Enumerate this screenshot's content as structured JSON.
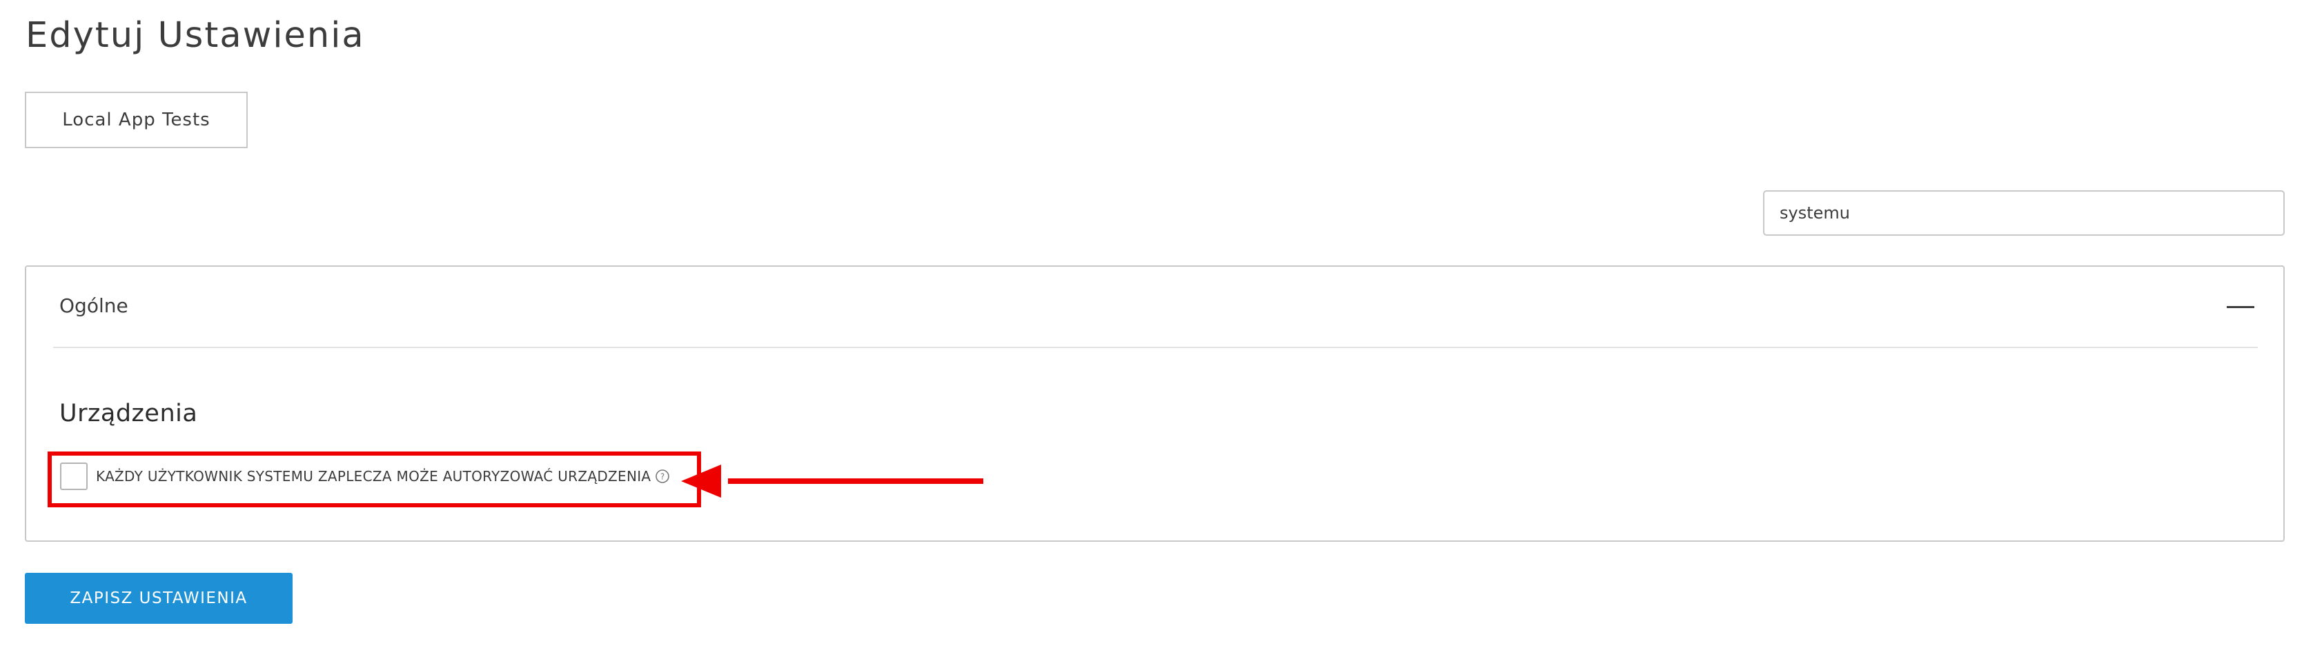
{
  "page": {
    "title": "Edytuj Ustawienia"
  },
  "tabs": {
    "active_label": "Local App Tests"
  },
  "search": {
    "value": "systemu"
  },
  "section": {
    "title": "Ogólne",
    "collapse_icon": "minus-icon",
    "group_heading": "Urządzenia",
    "settings": [
      {
        "label": "KAŻDY UŻYTKOWNIK SYSTEMU ZAPLECZA MOŻE AUTORYZOWAĆ URZĄDZENIA",
        "checked": false,
        "help_icon": "question-circle-icon"
      }
    ]
  },
  "actions": {
    "save_label": "ZAPISZ USTAWIENIA"
  },
  "colors": {
    "accent": "#1e91d6",
    "annotation": "#ee0000",
    "border": "#c8c8c8",
    "text": "#3c3c3c"
  }
}
